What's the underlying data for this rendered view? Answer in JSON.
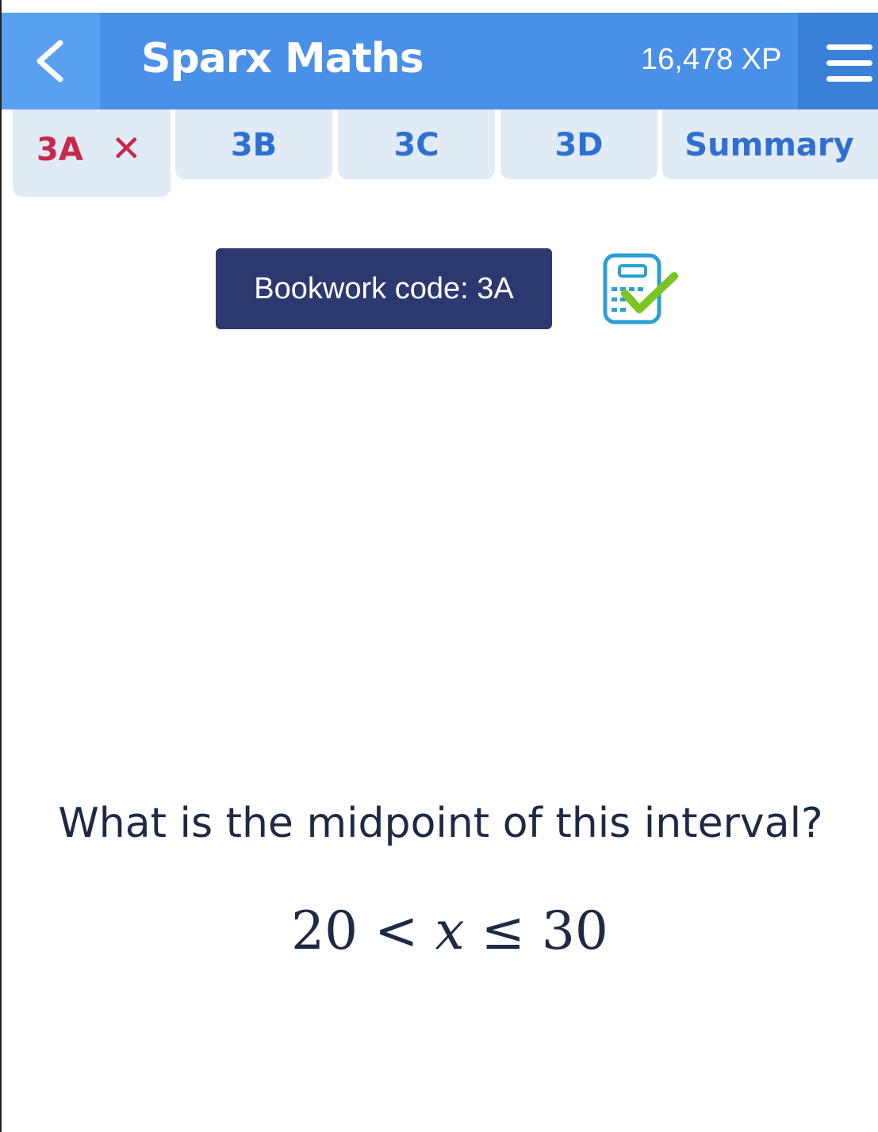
{
  "header": {
    "title": "Sparx Maths",
    "xp": "16,478 XP",
    "back_icon": "chevron-left-icon",
    "menu_icon": "hamburger-menu-icon",
    "color": "#4a90e8"
  },
  "tabs": [
    {
      "label": "3A",
      "status_icon": "close-icon",
      "status_color": "#c8284a",
      "active": true
    },
    {
      "label": "3B"
    },
    {
      "label": "3C"
    },
    {
      "label": "3D"
    },
    {
      "label": "Summary"
    }
  ],
  "bookwork": {
    "label": "Bookwork code: 3A",
    "icon": "calculator-allowed-check-icon"
  },
  "question": {
    "text": "What is the midpoint of this interval?",
    "math": {
      "left": "20",
      "op1": "<",
      "var": "x",
      "op2": "≤",
      "right": "30"
    }
  }
}
